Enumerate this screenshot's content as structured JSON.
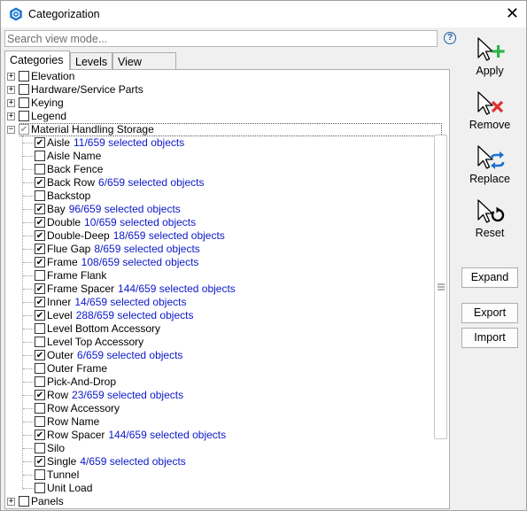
{
  "window": {
    "title": "Categorization",
    "accent_color": "#1e78d2"
  },
  "search": {
    "placeholder": "Search view mode...",
    "value": ""
  },
  "tabs": [
    {
      "label": "Categories",
      "active": true
    },
    {
      "label": "Levels",
      "active": false
    },
    {
      "label": "View Mode",
      "active": false
    }
  ],
  "tree": {
    "top_items": [
      {
        "label": "Elevation",
        "expander": "+",
        "state": "unchecked"
      },
      {
        "label": "Hardware/Service Parts",
        "expander": "+",
        "state": "unchecked"
      },
      {
        "label": "Keying",
        "expander": "+",
        "state": "unchecked"
      },
      {
        "label": "Legend",
        "expander": "+",
        "state": "unchecked"
      }
    ],
    "expanded_item": {
      "label": "Material Handling Storage",
      "expander": "−",
      "state": "indeterminate"
    },
    "children": [
      {
        "label": "Aisle",
        "checked": true,
        "count": "11/659 selected objects"
      },
      {
        "label": "Aisle Name",
        "checked": false,
        "count": ""
      },
      {
        "label": "Back Fence",
        "checked": false,
        "count": ""
      },
      {
        "label": "Back Row",
        "checked": true,
        "count": "6/659 selected objects"
      },
      {
        "label": "Backstop",
        "checked": false,
        "count": ""
      },
      {
        "label": "Bay",
        "checked": true,
        "count": "96/659 selected objects"
      },
      {
        "label": "Double",
        "checked": true,
        "count": "10/659 selected objects"
      },
      {
        "label": "Double-Deep",
        "checked": true,
        "count": "18/659 selected objects"
      },
      {
        "label": "Flue Gap",
        "checked": true,
        "count": "8/659 selected objects"
      },
      {
        "label": "Frame",
        "checked": true,
        "count": "108/659 selected objects"
      },
      {
        "label": "Frame Flank",
        "checked": false,
        "count": ""
      },
      {
        "label": "Frame Spacer",
        "checked": true,
        "count": "144/659 selected objects"
      },
      {
        "label": "Inner",
        "checked": true,
        "count": "14/659 selected objects"
      },
      {
        "label": "Level",
        "checked": true,
        "count": "288/659 selected objects"
      },
      {
        "label": "Level Bottom Accessory",
        "checked": false,
        "count": ""
      },
      {
        "label": "Level Top Accessory",
        "checked": false,
        "count": ""
      },
      {
        "label": "Outer",
        "checked": true,
        "count": "6/659 selected objects"
      },
      {
        "label": "Outer Frame",
        "checked": false,
        "count": ""
      },
      {
        "label": "Pick-And-Drop",
        "checked": false,
        "count": ""
      },
      {
        "label": "Row",
        "checked": true,
        "count": "23/659 selected objects"
      },
      {
        "label": "Row Accessory",
        "checked": false,
        "count": ""
      },
      {
        "label": "Row Name",
        "checked": false,
        "count": ""
      },
      {
        "label": "Row Spacer",
        "checked": true,
        "count": "144/659 selected objects"
      },
      {
        "label": "Silo",
        "checked": false,
        "count": ""
      },
      {
        "label": "Single",
        "checked": true,
        "count": "4/659 selected objects"
      },
      {
        "label": "Tunnel",
        "checked": false,
        "count": ""
      },
      {
        "label": "Unit Load",
        "checked": false,
        "count": ""
      }
    ],
    "bottom_items": [
      {
        "label": "Panels",
        "expander": "+",
        "state": "unchecked"
      }
    ],
    "count_color": "#0c18c8"
  },
  "tools": {
    "apply": {
      "label": "Apply",
      "icon": "cursor-plus-icon",
      "color": "#2fb34a"
    },
    "remove": {
      "label": "Remove",
      "icon": "cursor-x-icon",
      "color": "#e03030"
    },
    "replace": {
      "label": "Replace",
      "icon": "cursor-swap-icon",
      "color": "#1b6fd0"
    },
    "reset": {
      "label": "Reset",
      "icon": "cursor-reset-icon",
      "color": "#000000"
    }
  },
  "buttons": {
    "expand": "Expand",
    "export": "Export",
    "import": "Import"
  }
}
